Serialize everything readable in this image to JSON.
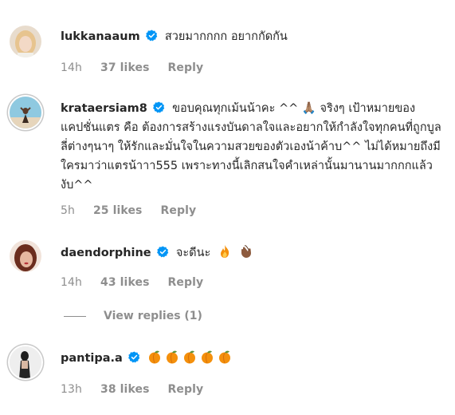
{
  "comments": [
    {
      "username": "lukkanaaum",
      "text": "สวยมากกกก อยากกัดกัน",
      "time": "14h",
      "likes": "37 likes",
      "reply": "Reply"
    },
    {
      "username": "krataersiam8",
      "text": "ขอบคุณทุกเม้นน้าคะ ^^ 🙏🏽 จริงๆ เป้าหมายของแคปชั่นแตร คือ ต้องการสร้างแรงบันดาลใจและอยากให้กำลังใจทุกคนที่ถูกบูลลี่ต่างๆนาๆ ให้รักและมั่นใจในความสวยของตัวเองน้าค้าบ^^ ไม่ได้หมายถึงมีใครมาว่าแตรน้าาา555 เพราะทางนี้เลิกสนใจคำเหล่านั้นมานานมากกกแล้วงับ^^",
      "time": "5h",
      "likes": "25 likes",
      "reply": "Reply"
    },
    {
      "username": "daendorphine",
      "text": "จะดีนะ",
      "emojis": [
        "fire",
        "clap"
      ],
      "time": "14h",
      "likes": "43 likes",
      "reply": "Reply"
    },
    {
      "username": "pantipa.a",
      "text": "",
      "emojis": [
        "peach",
        "peach",
        "peach",
        "peach",
        "peach"
      ],
      "time": "13h",
      "likes": "38 likes",
      "reply": "Reply"
    }
  ],
  "view_replies": "View replies (1)",
  "colors": {
    "verified": "#0095f6",
    "meta": "#8e8e8e",
    "text": "#262626"
  }
}
